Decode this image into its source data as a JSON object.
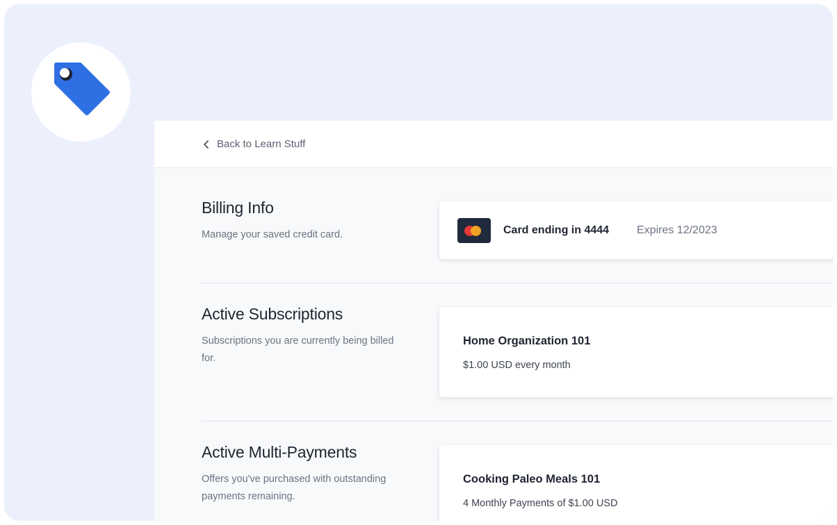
{
  "header": {
    "back_label": "Back to Learn Stuff"
  },
  "billing": {
    "title": "Billing Info",
    "description": "Manage your saved credit card.",
    "card_ending": "Card ending in 4444",
    "expires": "Expires  12/2023"
  },
  "subscriptions": {
    "title": "Active Subscriptions",
    "description": "Subscriptions you are currently being billed for.",
    "item_name": "Home Organization 101",
    "item_price": "$1.00 USD every month"
  },
  "multipayments": {
    "title": "Active Multi-Payments",
    "description": "Offers you've purchased with outstanding payments remaining.",
    "item_name": "Cooking Paleo Meals 101",
    "item_price": "4 Monthly Payments of $1.00 USD"
  },
  "colors": {
    "accent": "#2f6fe4",
    "frame_bg": "#ecf0fd",
    "panel_bg": "#f8f9fb"
  },
  "icons": {
    "badge": "price-tag-icon",
    "back": "chevron-left-icon",
    "card": "mastercard-icon"
  }
}
